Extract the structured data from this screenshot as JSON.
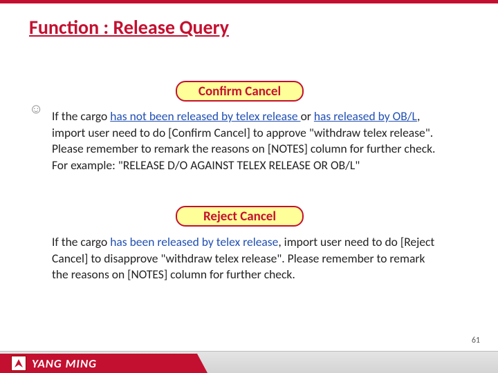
{
  "title": "Function : Release Query",
  "smiley": "☺",
  "badges": {
    "confirm": "Confirm Cancel",
    "reject": "Reject Cancel"
  },
  "p1": {
    "t1": "If the cargo ",
    "t2": "has not  been released by telex release ",
    "t3": "or ",
    "t4": "has released by OB/L",
    "t5": ", import user need to do [Confirm Cancel] to approve \"withdraw telex release\". Please remember to remark the reasons on [NOTES] column for further check. For example: \"RELEASE D/O AGAINST TELEX RELEASE OR OB/L\""
  },
  "p2": {
    "t1": "If the cargo ",
    "t2": "has been released by telex release",
    "t3": ", import user need to do [Reject Cancel] to disapprove \"withdraw telex release\". Please remember to remark the reasons on [NOTES] column for further check."
  },
  "page_number": "61",
  "brand": "YANG MING"
}
